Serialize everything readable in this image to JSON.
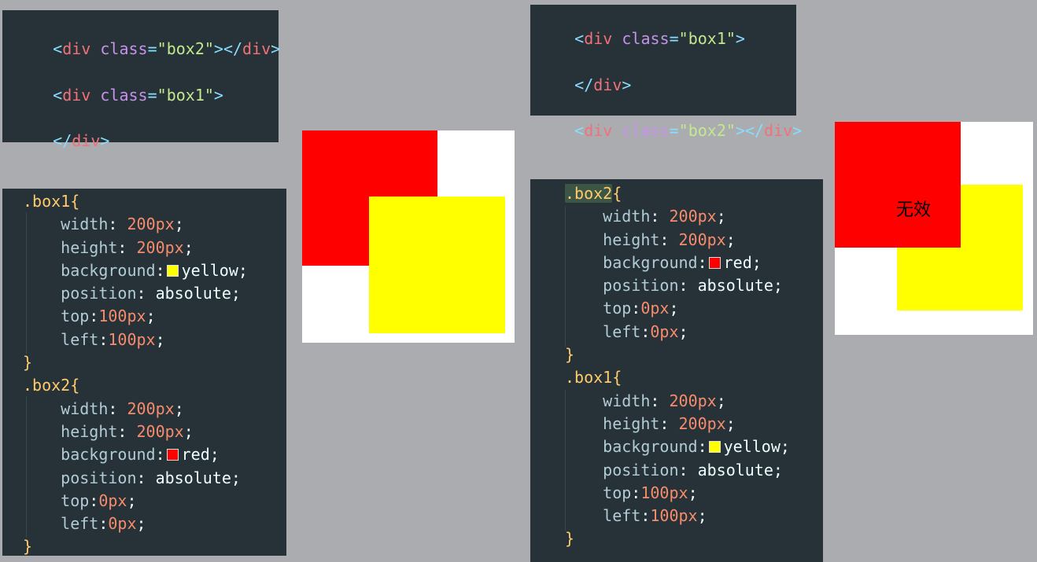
{
  "left_html": {
    "lines": [
      {
        "open": "<",
        "tag": "div",
        "attr": "class",
        "eq": "=",
        "str": "\"box2\"",
        "close": "></",
        "tag2": "div",
        "end": ">"
      },
      {
        "open": "<",
        "tag": "div",
        "attr": "class",
        "eq": "=",
        "str": "\"box1\"",
        "close": ">"
      },
      {
        "open": "</",
        "tag": "div",
        "close": ">"
      }
    ]
  },
  "left_css": {
    "box1_selector": ".box1{",
    "box1": [
      {
        "prop": "width",
        "sep": ": ",
        "value": "200px",
        "end": ";"
      },
      {
        "prop": "height",
        "sep": ": ",
        "value": "200px",
        "end": ";"
      },
      {
        "prop": "background",
        "sep": ":",
        "swatch": "#ffff00",
        "kw": "yellow",
        "end": ";"
      },
      {
        "prop": "position",
        "sep": ": ",
        "kw": "absolute",
        "end": ";"
      },
      {
        "prop": "top",
        "sep": ":",
        "value": "100px",
        "end": ";"
      },
      {
        "prop": "left",
        "sep": ":",
        "value": "100px",
        "end": ";"
      }
    ],
    "close": "}",
    "box2_selector": ".box2{",
    "box2": [
      {
        "prop": "width",
        "sep": ": ",
        "value": "200px",
        "end": ";"
      },
      {
        "prop": "height",
        "sep": ": ",
        "value": "200px",
        "end": ";"
      },
      {
        "prop": "background",
        "sep": ":",
        "swatch": "#ff0000",
        "kw": "red",
        "end": ";"
      },
      {
        "prop": "position",
        "sep": ": ",
        "kw": "absolute",
        "end": ";"
      },
      {
        "prop": "top",
        "sep": ":",
        "value": "0px",
        "end": ";"
      },
      {
        "prop": "left",
        "sep": ":",
        "value": "0px",
        "end": ";"
      }
    ]
  },
  "right_html": {
    "lines": [
      {
        "open": "<",
        "tag": "div",
        "attr": "class",
        "eq": "=",
        "str": "\"box1\"",
        "close": ">"
      },
      {
        "open": "</",
        "tag": "div",
        "close": ">"
      },
      {
        "open": "<",
        "tag": "div",
        "attr": "class",
        "eq": "=",
        "str": "\"box2\"",
        "close": "></",
        "tag2": "div",
        "end": ">"
      }
    ]
  },
  "right_css": {
    "box2_selector": ".box2",
    "box2_brace": "{",
    "box2": [
      {
        "prop": "width",
        "sep": ": ",
        "value": "200px",
        "end": ";"
      },
      {
        "prop": "height",
        "sep": ": ",
        "value": "200px",
        "end": ";"
      },
      {
        "prop": "background",
        "sep": ":",
        "swatch": "#ff0000",
        "kw": "red",
        "end": ";"
      },
      {
        "prop": "position",
        "sep": ": ",
        "kw": "absolute",
        "end": ";"
      },
      {
        "prop": "top",
        "sep": ":",
        "value": "0px",
        "end": ";"
      },
      {
        "prop": "left",
        "sep": ":",
        "value": "0px",
        "end": ";"
      }
    ],
    "close": "}",
    "box1_selector": ".box1{",
    "box1": [
      {
        "prop": "width",
        "sep": ": ",
        "value": "200px",
        "end": ";"
      },
      {
        "prop": "height",
        "sep": ": ",
        "value": "200px",
        "end": ";"
      },
      {
        "prop": "background",
        "sep": ":",
        "swatch": "#ffff00",
        "kw": "yellow",
        "end": ";"
      },
      {
        "prop": "position",
        "sep": ": ",
        "kw": "absolute",
        "end": ";"
      },
      {
        "prop": "top",
        "sep": ":",
        "value": "100px",
        "end": ";"
      },
      {
        "prop": "left",
        "sep": ":",
        "value": "100px",
        "end": ";"
      }
    ]
  },
  "right_demo": {
    "label": "无效"
  },
  "colors": {
    "page_bg": "#abacb0",
    "panel_bg": "#263238",
    "red": "#ff0000",
    "yellow": "#ffff00"
  }
}
